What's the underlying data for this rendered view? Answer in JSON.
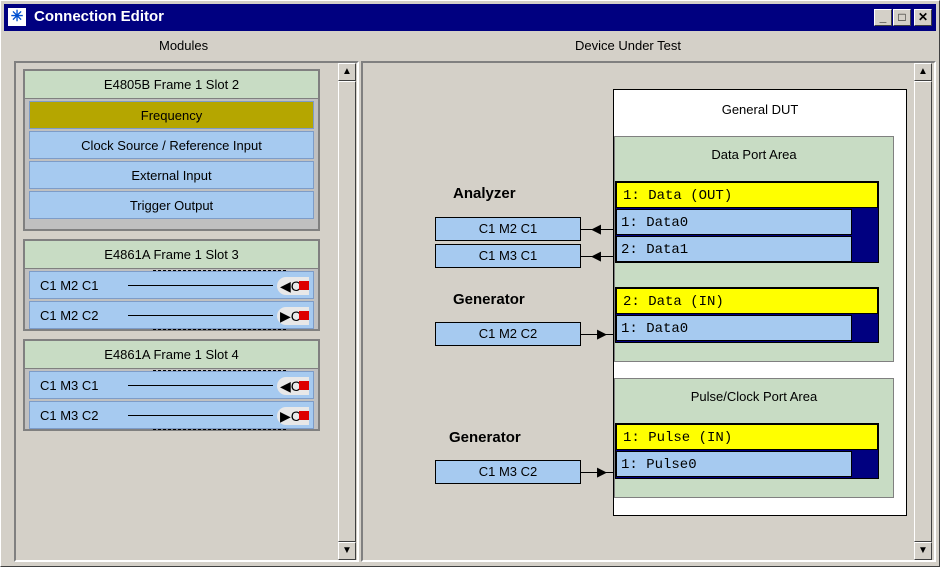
{
  "window": {
    "title": "Connection Editor",
    "icon": "asterisk-icon"
  },
  "controls": {
    "minimize": "_",
    "maximize": "□",
    "close": "✕"
  },
  "headers": {
    "left": "Modules",
    "right": "Device Under Test"
  },
  "modules": [
    {
      "title": "E4805B  Frame 1  Slot 2",
      "items": [
        "Frequency",
        "Clock Source / Reference Input",
        "External Input",
        "Trigger Output"
      ],
      "selected": "Frequency"
    },
    {
      "title": "E4861A  Frame 1  Slot 3",
      "channels": [
        "C1 M2 C1",
        "C1 M2 C2"
      ]
    },
    {
      "title": "E4861A  Frame 1  Slot 4",
      "channels": [
        "C1 M3 C1",
        "C1 M3 C2"
      ]
    }
  ],
  "dut": {
    "title": "General DUT",
    "data_area": {
      "title": "Data Port Area",
      "ports": [
        {
          "header": "1: Data (OUT)",
          "items": [
            "1: Data0",
            "2: Data1"
          ]
        },
        {
          "header": "2: Data (IN)",
          "items": [
            "1: Data0"
          ]
        }
      ]
    },
    "pulse_area": {
      "title": "Pulse/Clock Port Area",
      "ports": [
        {
          "header": "1: Pulse (IN)",
          "items": [
            "1: Pulse0"
          ]
        }
      ]
    }
  },
  "connections": {
    "analyzer_label": "Analyzer",
    "analyzer_channels": [
      "C1 M2 C1",
      "C1 M3 C1"
    ],
    "generator1_label": "Generator",
    "generator1_channels": [
      "C1 M2 C2"
    ],
    "generator2_label": "Generator",
    "generator2_channels": [
      "C1 M3 C2"
    ]
  },
  "colors": {
    "selected": "#b5a600",
    "item": "#a6caf0",
    "frame_head": "#c8dcc4",
    "port_head": "#ffff00",
    "titlebar": "#000080"
  }
}
